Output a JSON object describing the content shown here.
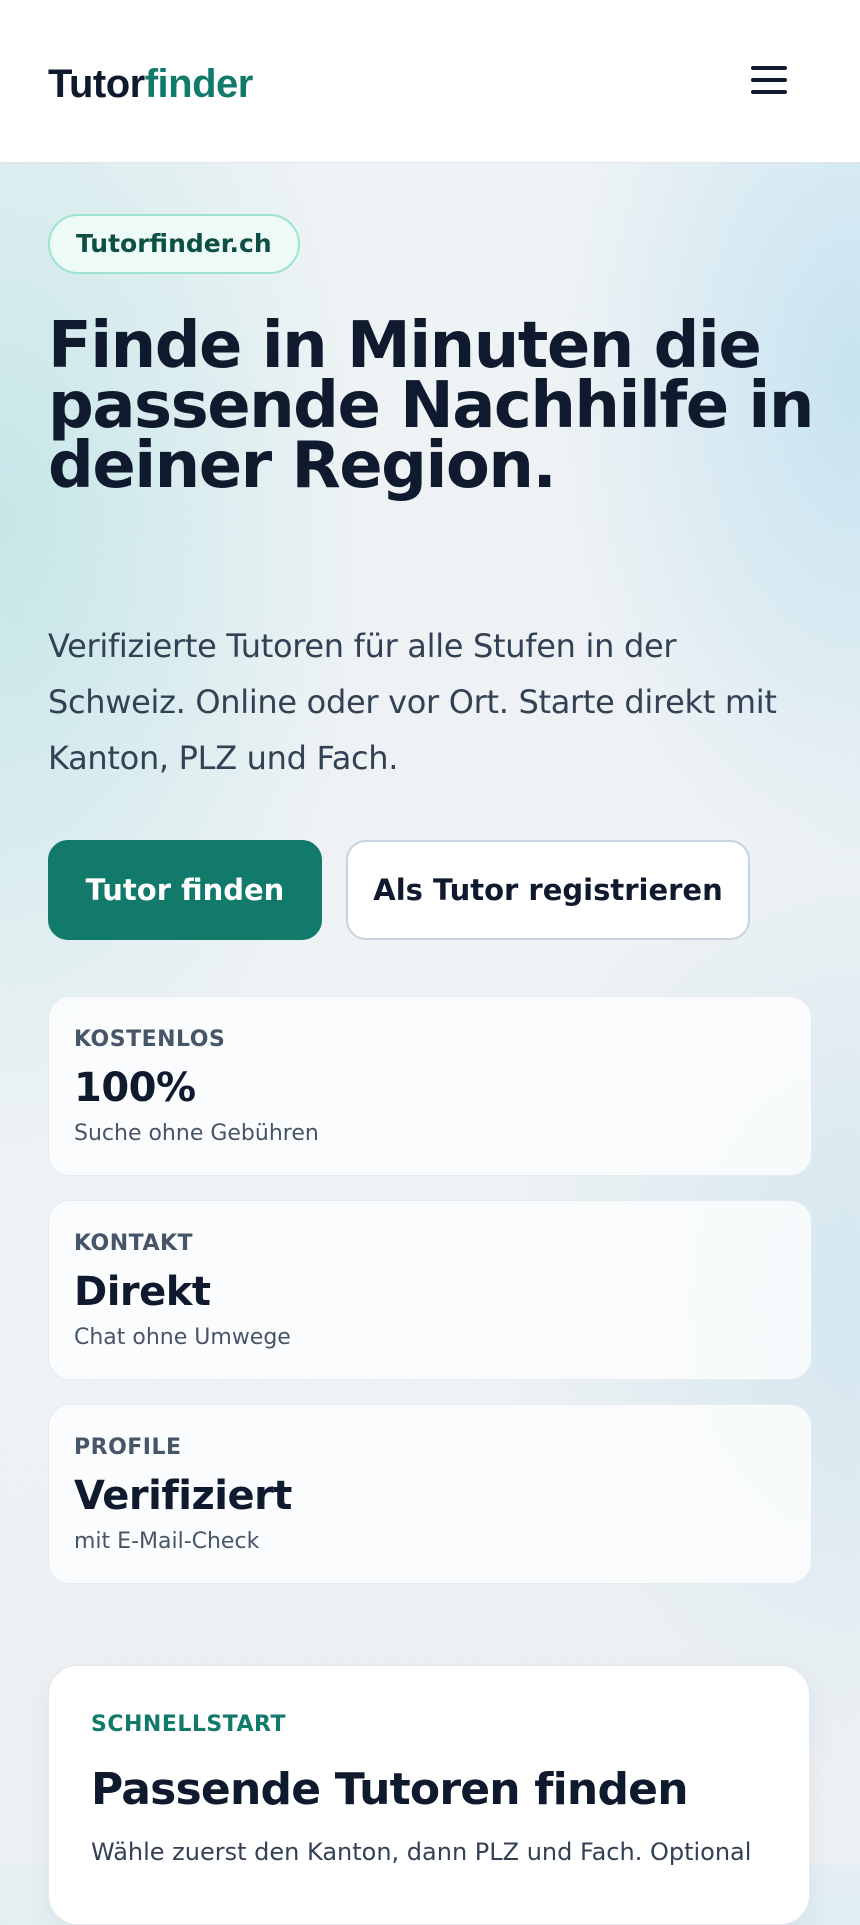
{
  "header": {
    "logo_part1": "Tutor",
    "logo_part2": "finder",
    "menu_icon": "hamburger-menu-icon",
    "brand_color": "#127a6b"
  },
  "hero": {
    "badge": "Tutorfinder.ch",
    "title": "Finde in Minuten die passende Nachhilfe in deiner Region.",
    "subtitle": "Verifizierte Tutoren für alle Stufen in der Schweiz. Online oder vor Ort. Starte direkt mit Kanton, PLZ und Fach.",
    "primary_button": "Tutor finden",
    "secondary_button": "Als Tutor registrieren"
  },
  "stats": [
    {
      "label": "KOSTENLOS",
      "value": "100%",
      "note": "Suche ohne Gebühren"
    },
    {
      "label": "KONTAKT",
      "value": "Direkt",
      "note": "Chat ohne Umwege"
    },
    {
      "label": "PROFILE",
      "value": "Verifiziert",
      "note": "mit E-Mail-Check"
    }
  ],
  "quickstart": {
    "eyebrow": "SCHNELLSTART",
    "title": "Passende Tutoren finden",
    "text": "Wähle zuerst den Kanton, dann PLZ und Fach. Optional"
  }
}
